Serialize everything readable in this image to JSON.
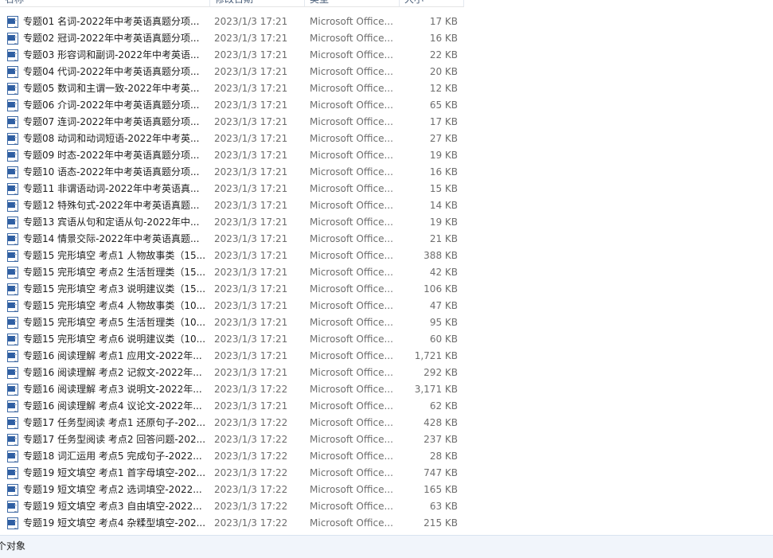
{
  "columns": {
    "name": "名称",
    "date": "修改日期",
    "type": "类型",
    "size": "大小"
  },
  "files": [
    {
      "name": "专题01 名词-2022年中考英语真题分项...",
      "date": "2023/1/3 17:21",
      "type": "Microsoft Office...",
      "size": "17 KB"
    },
    {
      "name": "专题02 冠词-2022年中考英语真题分项...",
      "date": "2023/1/3 17:21",
      "type": "Microsoft Office...",
      "size": "16 KB"
    },
    {
      "name": "专题03 形容词和副词-2022年中考英语...",
      "date": "2023/1/3 17:21",
      "type": "Microsoft Office...",
      "size": "22 KB"
    },
    {
      "name": "专题04 代词-2022年中考英语真题分项...",
      "date": "2023/1/3 17:21",
      "type": "Microsoft Office...",
      "size": "20 KB"
    },
    {
      "name": "专题05 数词和主谓一致-2022年中考英...",
      "date": "2023/1/3 17:21",
      "type": "Microsoft Office...",
      "size": "12 KB"
    },
    {
      "name": "专题06 介词-2022年中考英语真题分项...",
      "date": "2023/1/3 17:21",
      "type": "Microsoft Office...",
      "size": "65 KB"
    },
    {
      "name": "专题07 连词-2022年中考英语真题分项...",
      "date": "2023/1/3 17:21",
      "type": "Microsoft Office...",
      "size": "17 KB"
    },
    {
      "name": "专题08 动词和动词短语-2022年中考英...",
      "date": "2023/1/3 17:21",
      "type": "Microsoft Office...",
      "size": "27 KB"
    },
    {
      "name": "专题09 时态-2022年中考英语真题分项...",
      "date": "2023/1/3 17:21",
      "type": "Microsoft Office...",
      "size": "19 KB"
    },
    {
      "name": "专题10 语态-2022年中考英语真题分项...",
      "date": "2023/1/3 17:21",
      "type": "Microsoft Office...",
      "size": "16 KB"
    },
    {
      "name": "专题11 非谓语动词-2022年中考英语真...",
      "date": "2023/1/3 17:21",
      "type": "Microsoft Office...",
      "size": "15 KB"
    },
    {
      "name": "专题12 特殊句式-2022年中考英语真题...",
      "date": "2023/1/3 17:21",
      "type": "Microsoft Office...",
      "size": "14 KB"
    },
    {
      "name": "专题13 宾语从句和定语从句-2022年中...",
      "date": "2023/1/3 17:21",
      "type": "Microsoft Office...",
      "size": "19 KB"
    },
    {
      "name": "专题14 情景交际-2022年中考英语真题...",
      "date": "2023/1/3 17:21",
      "type": "Microsoft Office...",
      "size": "21 KB"
    },
    {
      "name": "专题15 完形填空 考点1 人物故事类（15...",
      "date": "2023/1/3 17:21",
      "type": "Microsoft Office...",
      "size": "388 KB"
    },
    {
      "name": "专题15 完形填空 考点2 生活哲理类（15...",
      "date": "2023/1/3 17:21",
      "type": "Microsoft Office...",
      "size": "42 KB"
    },
    {
      "name": "专题15 完形填空 考点3 说明建议类（15...",
      "date": "2023/1/3 17:21",
      "type": "Microsoft Office...",
      "size": "106 KB"
    },
    {
      "name": "专题15 完形填空 考点4 人物故事类（10...",
      "date": "2023/1/3 17:21",
      "type": "Microsoft Office...",
      "size": "47 KB"
    },
    {
      "name": "专题15 完形填空 考点5 生活哲理类（10...",
      "date": "2023/1/3 17:21",
      "type": "Microsoft Office...",
      "size": "95 KB"
    },
    {
      "name": "专题15 完形填空 考点6 说明建议类（10...",
      "date": "2023/1/3 17:21",
      "type": "Microsoft Office...",
      "size": "60 KB"
    },
    {
      "name": "专题16 阅读理解 考点1 应用文-2022年...",
      "date": "2023/1/3 17:21",
      "type": "Microsoft Office...",
      "size": "1,721 KB"
    },
    {
      "name": "专题16 阅读理解 考点2 记叙文-2022年...",
      "date": "2023/1/3 17:21",
      "type": "Microsoft Office...",
      "size": "292 KB"
    },
    {
      "name": "专题16 阅读理解 考点3 说明文-2022年...",
      "date": "2023/1/3 17:22",
      "type": "Microsoft Office...",
      "size": "3,171 KB"
    },
    {
      "name": "专题16 阅读理解 考点4 议论文-2022年...",
      "date": "2023/1/3 17:21",
      "type": "Microsoft Office...",
      "size": "62 KB"
    },
    {
      "name": "专题17 任务型阅读 考点1 还原句子-202...",
      "date": "2023/1/3 17:22",
      "type": "Microsoft Office...",
      "size": "428 KB"
    },
    {
      "name": "专题17 任务型阅读 考点2 回答问题-202...",
      "date": "2023/1/3 17:22",
      "type": "Microsoft Office...",
      "size": "237 KB"
    },
    {
      "name": "专题18 词汇运用 考点5 完成句子-2022...",
      "date": "2023/1/3 17:22",
      "type": "Microsoft Office...",
      "size": "28 KB"
    },
    {
      "name": "专题19 短文填空 考点1 首字母填空-202...",
      "date": "2023/1/3 17:22",
      "type": "Microsoft Office...",
      "size": "747 KB"
    },
    {
      "name": "专题19 短文填空 考点2 选词填空-2022...",
      "date": "2023/1/3 17:22",
      "type": "Microsoft Office...",
      "size": "165 KB"
    },
    {
      "name": "专题19 短文填空 考点3 自由填空-2022...",
      "date": "2023/1/3 17:22",
      "type": "Microsoft Office...",
      "size": "63 KB"
    },
    {
      "name": "专题19 短文填空 考点4 杂糅型填空-202...",
      "date": "2023/1/3 17:22",
      "type": "Microsoft Office...",
      "size": "215 KB"
    }
  ],
  "icon": "word-document-icon",
  "status": {
    "text": "个对象"
  }
}
